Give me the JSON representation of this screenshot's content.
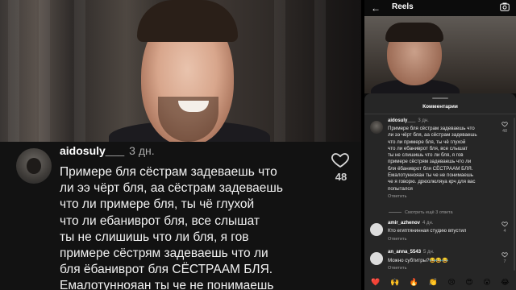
{
  "left": {
    "username": "aidosuly___",
    "time": "3 дн.",
    "comment_lines": [
      "Примере бля сёстрам задеваешь что",
      "ли ээ чёрт бля,  аа сёстрам задеваешь",
      "что ли примере бля,  ты чё глухой",
      "что ли ебаниврот бля,  все слышат",
      "ты не слишишь что ли бля,  я гов",
      "примере сёстрям задеваешь что ли",
      "бля ёбаниврот бля  СЁСТРААМ БЛЯ.",
      "Емалотуннояан  ты че не понимаешь"
    ],
    "likes": "48"
  },
  "right": {
    "title": "Reels",
    "sheet_title": "Комментарии",
    "main_comment": {
      "username": "aidosuly___",
      "time": "3 дн.",
      "lines": [
        "Примере бля сёстрам задеваешь что",
        "ли ээ чёрт бля,  аа сёстрам задеваешь",
        "что ли примере бля,  ты чё глухой",
        "что ли ебаниврот бля,  все слышат",
        "ты не слишишь что ли бля,  я гов",
        "примере сёстрям задеваешь что ли",
        "бля ёбаниврот бля  СЁСТРААМ БЛЯ.",
        "Емалотуннояан  ты че не понимаешь",
        "че я говорю. дрюолюляуа  крч для вас",
        "попытался"
      ],
      "reply": "Ответить",
      "likes": "48"
    },
    "view_replies": "Смотреть ещё 3 ответа",
    "comments": [
      {
        "username": "amir_azhenov",
        "time": "4 дн.",
        "text": "Кто египтянинная студию впустил",
        "reply": "Ответить",
        "likes": "4"
      },
      {
        "username": "an_anna_5543",
        "time": "5 дн.",
        "text": "Можно субтитры?😂😂😂",
        "reply": "Ответить",
        "likes": "7"
      }
    ],
    "emojis": [
      "❤️",
      "🙌",
      "🔥",
      "👏",
      "😢",
      "😍",
      "😮",
      "😂"
    ]
  }
}
